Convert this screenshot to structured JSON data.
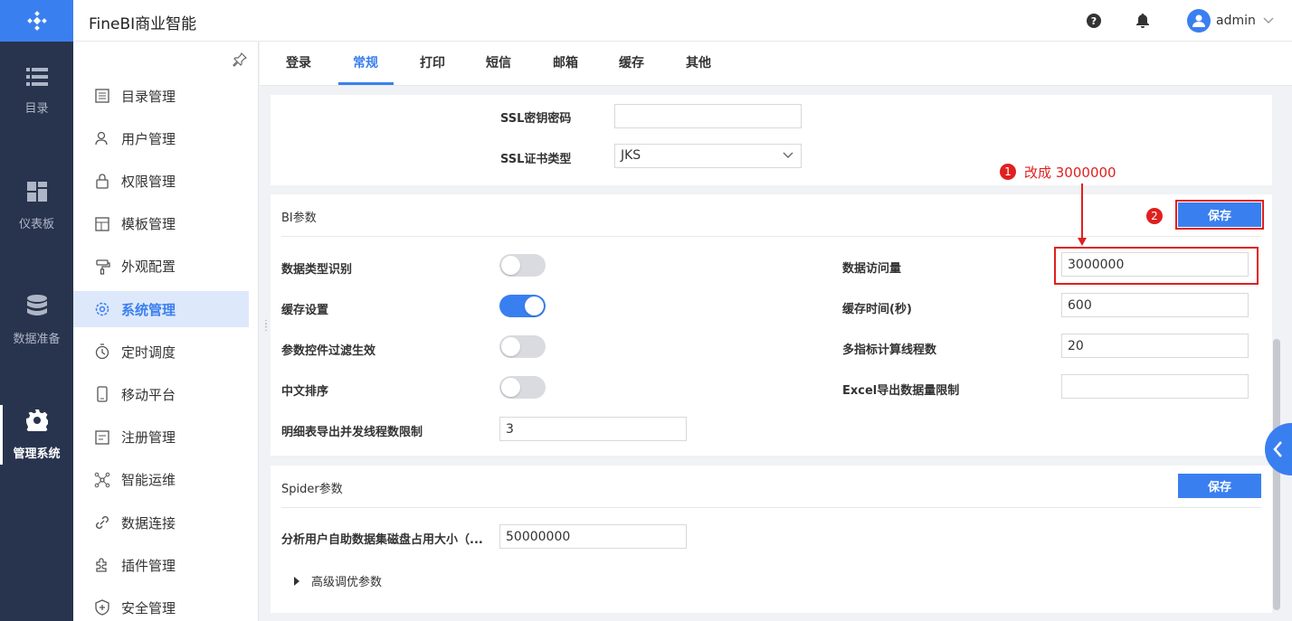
{
  "app": {
    "title": "FineBI商业智能"
  },
  "header": {
    "user": "admin"
  },
  "rail": [
    {
      "label": "目录",
      "icon": "catalog-icon"
    },
    {
      "label": "仪表板",
      "icon": "dashboard-icon"
    },
    {
      "label": "数据准备",
      "icon": "database-icon"
    },
    {
      "label": "管理系统",
      "icon": "gear-icon",
      "active": true
    }
  ],
  "menu": [
    {
      "label": "目录管理",
      "icon": "catalog-manage-icon"
    },
    {
      "label": "用户管理",
      "icon": "user-icon"
    },
    {
      "label": "权限管理",
      "icon": "lock-icon"
    },
    {
      "label": "模板管理",
      "icon": "template-icon"
    },
    {
      "label": "外观配置",
      "icon": "paint-icon"
    },
    {
      "label": "系统管理",
      "icon": "settings-icon",
      "active": true
    },
    {
      "label": "定时调度",
      "icon": "timer-icon"
    },
    {
      "label": "移动平台",
      "icon": "mobile-icon"
    },
    {
      "label": "注册管理",
      "icon": "register-icon"
    },
    {
      "label": "智能运维",
      "icon": "ops-icon"
    },
    {
      "label": "数据连接",
      "icon": "link-icon"
    },
    {
      "label": "插件管理",
      "icon": "plugin-icon"
    },
    {
      "label": "安全管理",
      "icon": "shield-icon"
    }
  ],
  "tabs": [
    {
      "label": "登录"
    },
    {
      "label": "常规",
      "active": true
    },
    {
      "label": "打印"
    },
    {
      "label": "短信"
    },
    {
      "label": "邮箱"
    },
    {
      "label": "缓存"
    },
    {
      "label": "其他"
    }
  ],
  "ssl": {
    "password_label": "SSL密钥密码",
    "password_value": "",
    "cert_type_label": "SSL证书类型",
    "cert_type_value": "JKS"
  },
  "bi": {
    "title": "BI参数",
    "save": "保存",
    "left": [
      {
        "label": "数据类型识别",
        "type": "toggle",
        "on": false
      },
      {
        "label": "缓存设置",
        "type": "toggle",
        "on": true
      },
      {
        "label": "参数控件过滤生效",
        "type": "toggle",
        "on": false
      },
      {
        "label": "中文排序",
        "type": "toggle",
        "on": false
      },
      {
        "label": "明细表导出并发线程数限制",
        "type": "input",
        "value": "3"
      }
    ],
    "right": [
      {
        "label": "数据访问量",
        "value": "3000000"
      },
      {
        "label": "缓存时间(秒)",
        "value": "600"
      },
      {
        "label": "多指标计算线程数",
        "value": "20"
      },
      {
        "label": "Excel导出数据量限制",
        "value": ""
      }
    ]
  },
  "spider": {
    "title": "Spider参数",
    "save": "保存",
    "disk_label": "分析用户自助数据集磁盘占用大小（...",
    "disk_value": "50000000",
    "advanced": "高级调优参数"
  },
  "annotations": {
    "step1_num": "1",
    "step1_text": "改成 3000000",
    "step2_num": "2"
  },
  "colors": {
    "accent": "#3a7ff0",
    "rail": "#28344e",
    "annotation": "#e02020"
  }
}
